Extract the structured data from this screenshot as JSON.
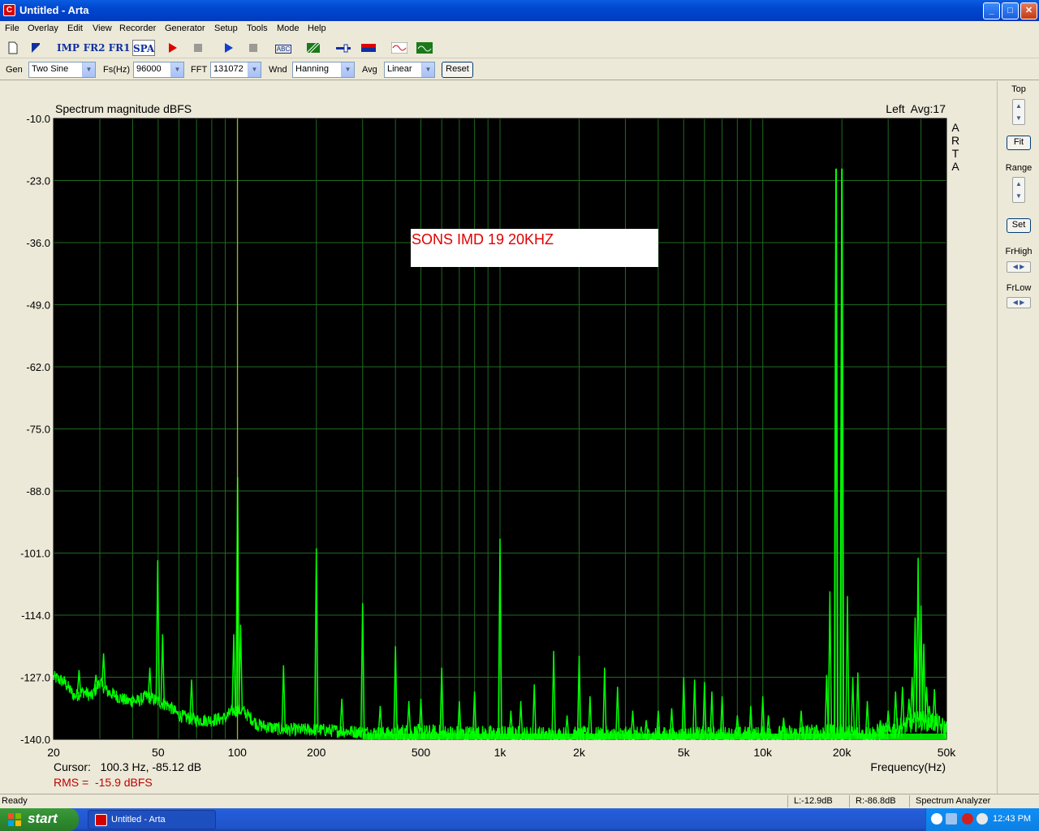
{
  "window": {
    "title": "Untitled - Arta",
    "minimize": "_",
    "maximize": "□",
    "close": "✕"
  },
  "menu": [
    "File",
    "Overlay",
    "Edit",
    "View",
    "Recorder",
    "Generator",
    "Setup",
    "Tools",
    "Mode",
    "Help"
  ],
  "toolbar": {
    "imp": "IMP",
    "fr2": "FR2",
    "fr1": "FR1",
    "spa": "SPA",
    "abc": "ABC"
  },
  "controls": {
    "gen_label": "Gen",
    "gen_value": "Two Sine",
    "fs_label": "Fs(Hz)",
    "fs_value": "96000",
    "fft_label": "FFT",
    "fft_value": "131072",
    "wnd_label": "Wnd",
    "wnd_value": "Hanning",
    "avg_label": "Avg",
    "avg_value": "Linear",
    "reset": "Reset"
  },
  "side_panel": {
    "top": "Top",
    "fit": "Fit",
    "range": "Range",
    "set": "Set",
    "frhigh": "FrHigh",
    "frlow": "FrLow"
  },
  "colors": {
    "plot_bg": "#000000",
    "grid": "#1f6b1f",
    "trace": "#00ff00",
    "cursor": "#c8c800",
    "annotation": "#e00000",
    "rms": "#c00000"
  },
  "chart_data": {
    "type": "line",
    "title": "Spectrum magnitude dBFS",
    "channel_info": "Left  Avg:17",
    "side_label": "ARTA",
    "xlabel": "Frequency(Hz)",
    "x_scale": "log",
    "xlim": [
      20,
      50000
    ],
    "ylim": [
      -140,
      -10
    ],
    "y_ticks": [
      "-10.0",
      "-23.0",
      "-36.0",
      "-49.0",
      "-62.0",
      "-75.0",
      "-88.0",
      "-101.0",
      "-114.0",
      "-127.0",
      "-140.0"
    ],
    "x_ticks": [
      {
        "f": 20,
        "label": "20"
      },
      {
        "f": 50,
        "label": "50"
      },
      {
        "f": 100,
        "label": "100"
      },
      {
        "f": 200,
        "label": "200"
      },
      {
        "f": 500,
        "label": "500"
      },
      {
        "f": 1000,
        "label": "1k"
      },
      {
        "f": 2000,
        "label": "2k"
      },
      {
        "f": 5000,
        "label": "5k"
      },
      {
        "f": 10000,
        "label": "10k"
      },
      {
        "f": 20000,
        "label": "20k"
      },
      {
        "f": 50000,
        "label": "50k"
      }
    ],
    "grid": true,
    "annotation": "SONS IMD 19 20KHZ",
    "cursor_frequency_hz": 100.3,
    "cursor_text": "Cursor:   100.3 Hz, -85.12 dB",
    "rms_text": "RMS =  -15.9 dBFS",
    "floor": [
      [
        20,
        -127
      ],
      [
        22,
        -128
      ],
      [
        24,
        -131
      ],
      [
        26,
        -130
      ],
      [
        28,
        -131
      ],
      [
        30,
        -128
      ],
      [
        32,
        -130
      ],
      [
        35,
        -131
      ],
      [
        38,
        -132
      ],
      [
        42,
        -132
      ],
      [
        45,
        -131
      ],
      [
        55,
        -133
      ],
      [
        60,
        -135
      ],
      [
        70,
        -136
      ],
      [
        80,
        -136
      ],
      [
        90,
        -135.5
      ],
      [
        96,
        -134
      ],
      [
        105,
        -134
      ],
      [
        120,
        -137
      ],
      [
        150,
        -138
      ],
      [
        200,
        -138
      ],
      [
        300,
        -138.5
      ],
      [
        500,
        -139
      ],
      [
        1000,
        -139.3
      ],
      [
        2000,
        -139.5
      ],
      [
        5000,
        -139.5
      ],
      [
        10000,
        -139.4
      ],
      [
        15000,
        -139
      ],
      [
        20000,
        -139
      ],
      [
        25000,
        -139.2
      ],
      [
        30000,
        -138.5
      ],
      [
        35000,
        -137
      ],
      [
        40000,
        -136
      ],
      [
        45000,
        -136.5
      ],
      [
        50000,
        -138
      ]
    ],
    "peaks": [
      {
        "f": 22.5,
        "db": -129
      },
      {
        "f": 25,
        "db": -125.5
      },
      {
        "f": 27,
        "db": -130
      },
      {
        "f": 29,
        "db": -126.5
      },
      {
        "f": 31,
        "db": -122
      },
      {
        "f": 34,
        "db": -131
      },
      {
        "f": 40,
        "db": -131
      },
      {
        "f": 46.5,
        "db": -125
      },
      {
        "f": 49.8,
        "db": -102.5
      },
      {
        "f": 52,
        "db": -118
      },
      {
        "f": 67,
        "db": -127.5
      },
      {
        "f": 97,
        "db": -118
      },
      {
        "f": 100.3,
        "db": -85.12
      },
      {
        "f": 103,
        "db": -116
      },
      {
        "f": 150,
        "db": -124.5
      },
      {
        "f": 200,
        "db": -100
      },
      {
        "f": 250,
        "db": -131.5
      },
      {
        "f": 300,
        "db": -111.5
      },
      {
        "f": 350,
        "db": -133
      },
      {
        "f": 400,
        "db": -120.5
      },
      {
        "f": 450,
        "db": -132
      },
      {
        "f": 500,
        "db": -131.5
      },
      {
        "f": 600,
        "db": -125
      },
      {
        "f": 700,
        "db": -132
      },
      {
        "f": 800,
        "db": -130
      },
      {
        "f": 1000,
        "db": -98
      },
      {
        "f": 1100,
        "db": -134
      },
      {
        "f": 1200,
        "db": -132
      },
      {
        "f": 1350,
        "db": -128.5
      },
      {
        "f": 1600,
        "db": -121.5
      },
      {
        "f": 1800,
        "db": -135
      },
      {
        "f": 2000,
        "db": -122.5
      },
      {
        "f": 2200,
        "db": -131
      },
      {
        "f": 2500,
        "db": -125
      },
      {
        "f": 2800,
        "db": -129
      },
      {
        "f": 3200,
        "db": -134
      },
      {
        "f": 3600,
        "db": -136
      },
      {
        "f": 4000,
        "db": -134
      },
      {
        "f": 4500,
        "db": -133.5
      },
      {
        "f": 5000,
        "db": -127
      },
      {
        "f": 5500,
        "db": -127.5
      },
      {
        "f": 6000,
        "db": -128
      },
      {
        "f": 6400,
        "db": -130
      },
      {
        "f": 7000,
        "db": -131
      },
      {
        "f": 8000,
        "db": -135
      },
      {
        "f": 9000,
        "db": -133
      },
      {
        "f": 10000,
        "db": -131
      },
      {
        "f": 10500,
        "db": -135
      },
      {
        "f": 12000,
        "db": -135.5
      },
      {
        "f": 14000,
        "db": -134
      },
      {
        "f": 16000,
        "db": -137
      },
      {
        "f": 17500,
        "db": -126.5
      },
      {
        "f": 18000,
        "db": -109
      },
      {
        "f": 18500,
        "db": -137
      },
      {
        "f": 19000,
        "db": -20.5
      },
      {
        "f": 20000,
        "db": -20.5
      },
      {
        "f": 21000,
        "db": -110
      },
      {
        "f": 22000,
        "db": -127
      },
      {
        "f": 23000,
        "db": -126
      },
      {
        "f": 25000,
        "db": -132
      },
      {
        "f": 28000,
        "db": -136
      },
      {
        "f": 30000,
        "db": -134
      },
      {
        "f": 32000,
        "db": -130
      },
      {
        "f": 34000,
        "db": -129
      },
      {
        "f": 36000,
        "db": -131.5
      },
      {
        "f": 37000,
        "db": -127
      },
      {
        "f": 38000,
        "db": -114.5
      },
      {
        "f": 39000,
        "db": -102
      },
      {
        "f": 40000,
        "db": -112
      },
      {
        "f": 41000,
        "db": -120
      },
      {
        "f": 42000,
        "db": -129
      },
      {
        "f": 43000,
        "db": -133
      },
      {
        "f": 45000,
        "db": -129.5
      }
    ]
  },
  "status": {
    "ready": "Ready",
    "left_level": "L:-12.9dB",
    "right_level": "R:-86.8dB",
    "mode": "Spectrum Analyzer"
  },
  "taskbar": {
    "start": "start",
    "task": "Untitled - Arta",
    "clock": "12:43 PM"
  }
}
